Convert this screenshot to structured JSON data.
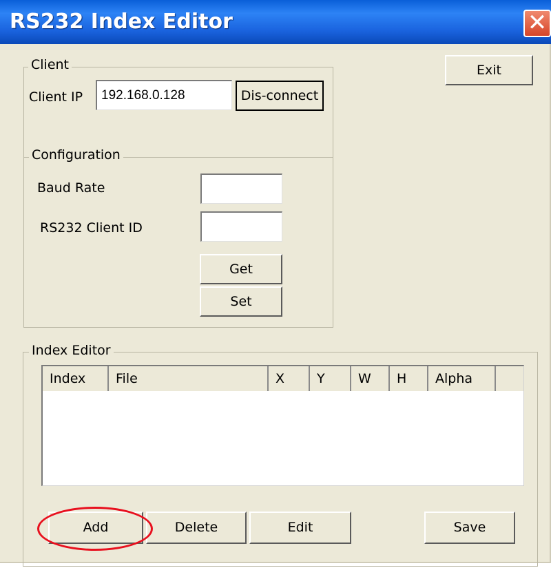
{
  "window": {
    "title": "RS232 Index Editor",
    "close_glyph": "✕"
  },
  "client": {
    "group_label": "Client",
    "ip_label": "Client IP",
    "ip_value": "192.168.0.128",
    "disconnect_label": "Dis-connect"
  },
  "exit_label": "Exit",
  "configuration": {
    "group_label": "Configuration",
    "baud_label": "Baud Rate",
    "baud_value": "",
    "client_id_label": "RS232 Client ID",
    "client_id_value": "",
    "get_label": "Get",
    "set_label": "Set"
  },
  "index_editor": {
    "group_label": "Index Editor",
    "columns": [
      "Index",
      "File",
      "X",
      "Y",
      "W",
      "H",
      "Alpha",
      ""
    ],
    "rows": []
  },
  "actions": {
    "add_label": "Add",
    "delete_label": "Delete",
    "edit_label": "Edit",
    "save_label": "Save"
  },
  "annotation": {
    "color": "#e8101e",
    "target": "add-button"
  }
}
